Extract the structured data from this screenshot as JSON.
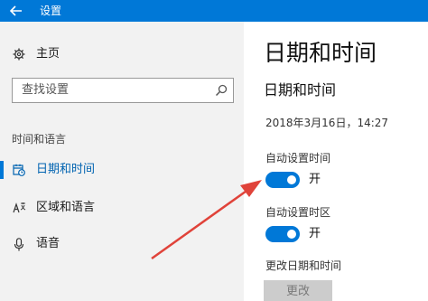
{
  "window": {
    "title": "设置"
  },
  "sidebar": {
    "home_label": "主页",
    "search": {
      "placeholder": "查找设置"
    },
    "section_header": "时间和语言",
    "items": [
      {
        "label": "日期和时间",
        "icon": "calendar-clock-icon",
        "active": true
      },
      {
        "label": "区域和语言",
        "icon": "language-icon",
        "active": false
      },
      {
        "label": "语音",
        "icon": "microphone-icon",
        "active": false
      }
    ]
  },
  "main": {
    "page_title": "日期和时间",
    "sub_title": "日期和时间",
    "current_datetime": "2018年3月16日，14:27",
    "auto_time": {
      "label": "自动设置时间",
      "state": "开",
      "on": true
    },
    "auto_timezone": {
      "label": "自动设置时区",
      "state": "开",
      "on": true
    },
    "change_section": {
      "label": "更改日期和时间",
      "button": "更改"
    }
  },
  "colors": {
    "accent": "#0078d7",
    "arrow": "#e0433a",
    "sidebar_bg": "#f2f2f2"
  }
}
